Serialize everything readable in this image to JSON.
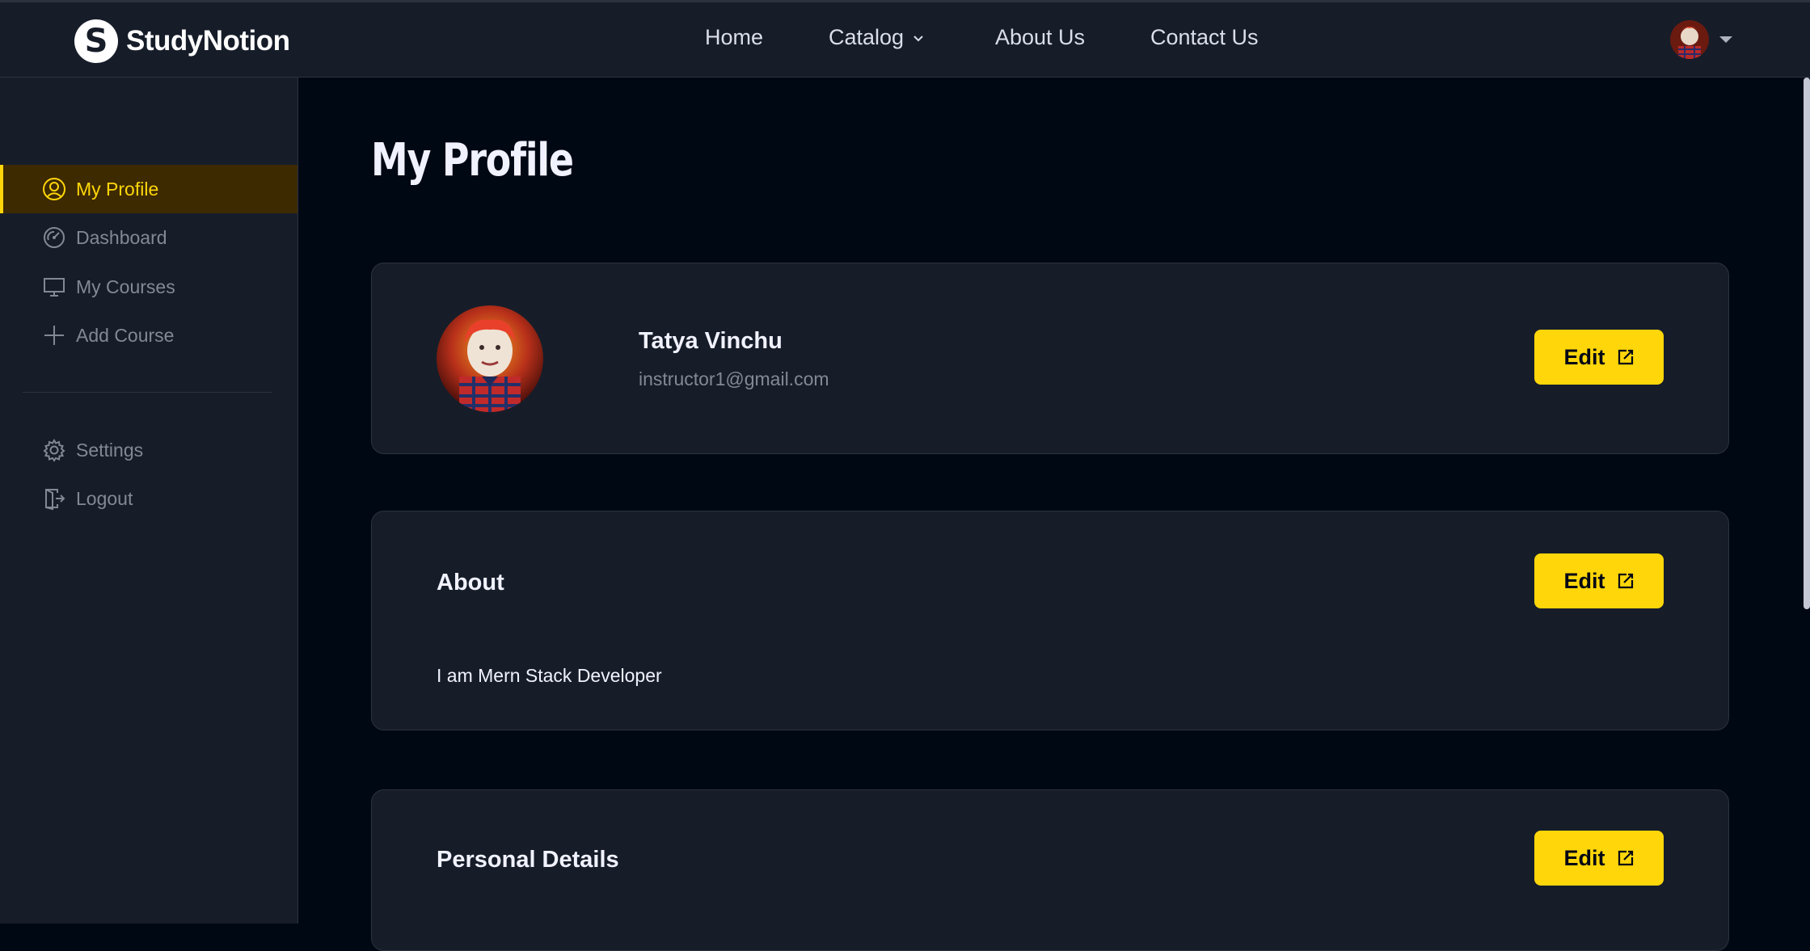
{
  "brand": {
    "name": "StudyNotion",
    "logo_letter": "S"
  },
  "nav": {
    "items": [
      {
        "label": "Home"
      },
      {
        "label": "Catalog"
      },
      {
        "label": "About Us"
      },
      {
        "label": "Contact Us"
      }
    ]
  },
  "sidebar": {
    "items": [
      {
        "label": "My Profile",
        "icon": "user-circle-icon",
        "active": true
      },
      {
        "label": "Dashboard",
        "icon": "gauge-icon"
      },
      {
        "label": "My Courses",
        "icon": "monitor-icon"
      },
      {
        "label": "Add Course",
        "icon": "plus-icon"
      }
    ],
    "bottom_items": [
      {
        "label": "Settings",
        "icon": "gear-icon"
      },
      {
        "label": "Logout",
        "icon": "logout-icon"
      }
    ]
  },
  "page": {
    "title": "My Profile"
  },
  "profile_card": {
    "name": "Tatya Vinchu",
    "email": "instructor1@gmail.com",
    "edit_label": "Edit"
  },
  "about_card": {
    "heading": "About",
    "text": "I am Mern Stack Developer",
    "edit_label": "Edit"
  },
  "personal_card": {
    "heading": "Personal Details",
    "edit_label": "Edit"
  },
  "colors": {
    "accent": "#FFD60A",
    "background": "#000814",
    "panel": "#161D29",
    "active_bg": "#3D2A01"
  }
}
